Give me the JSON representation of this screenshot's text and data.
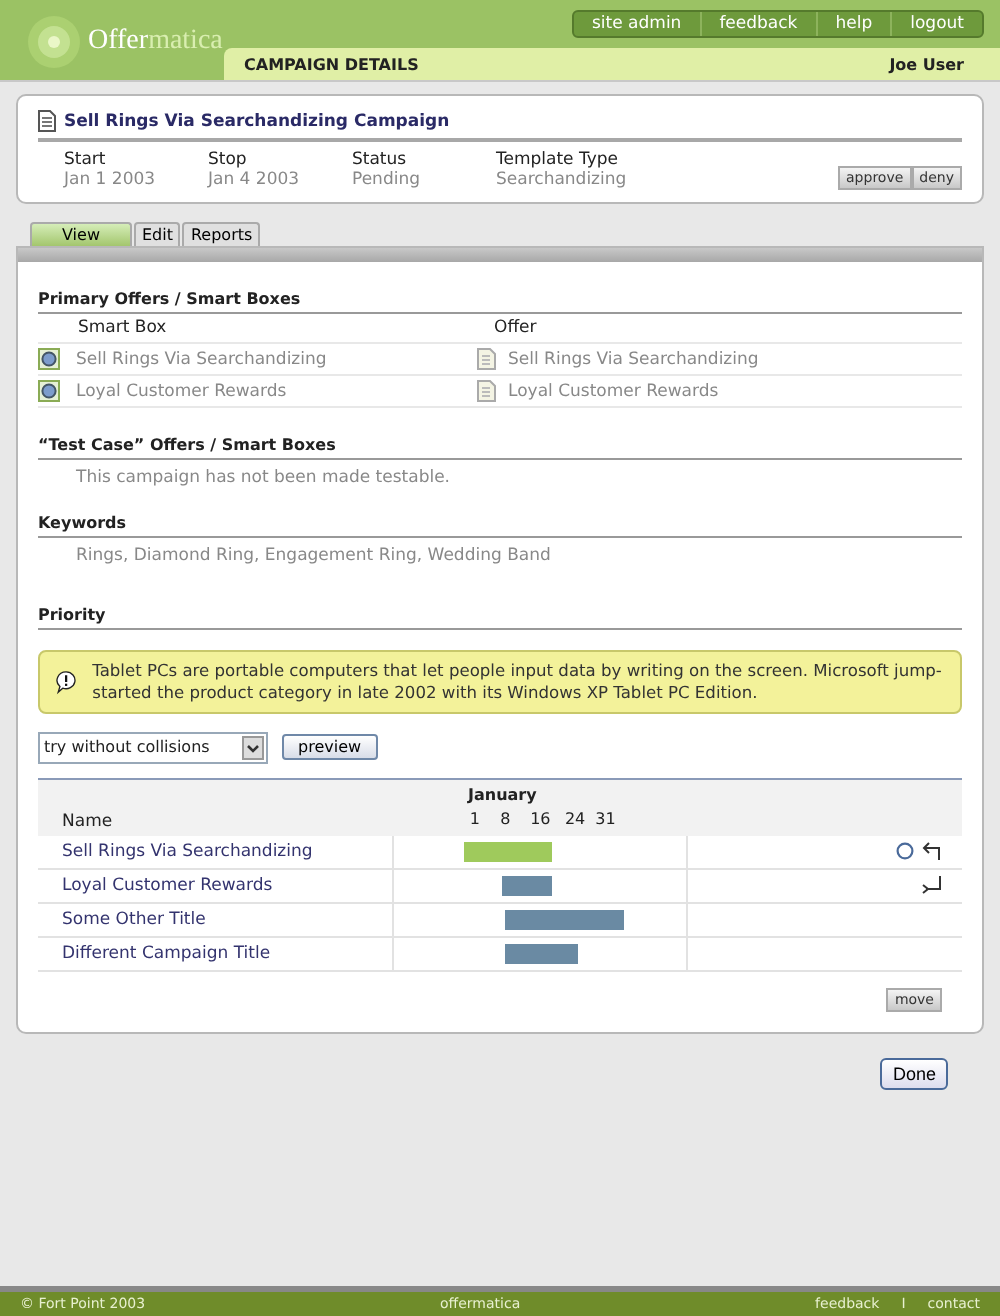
{
  "header": {
    "logo": [
      "Offer",
      "matica"
    ],
    "nav": [
      "site admin",
      "feedback",
      "help",
      "logout"
    ],
    "section_title": "CAMPAIGN DETAILS",
    "user": "Joe User"
  },
  "campaign": {
    "title": "Sell Rings Via Searchandizing Campaign",
    "fields": [
      {
        "label": "Start",
        "value": "Jan 1 2003"
      },
      {
        "label": "Stop",
        "value": "Jan 4 2003"
      },
      {
        "label": "Status",
        "value": "Pending"
      },
      {
        "label": "Template Type",
        "value": "Searchandizing"
      }
    ],
    "buttons": [
      "approve",
      "deny"
    ]
  },
  "tabs": [
    {
      "label": "View",
      "selected": true
    },
    {
      "label": "Edit",
      "selected": false
    },
    {
      "label": "Reports",
      "selected": false
    }
  ],
  "primary": {
    "heading": "Primary Offers / Smart Boxes",
    "columns": [
      "Smart Box",
      "Offer"
    ],
    "rows": [
      {
        "smart_box": "Sell Rings Via Searchandizing",
        "offer": "Sell Rings Via Searchandizing"
      },
      {
        "smart_box": "Loyal Customer Rewards",
        "offer": "Loyal Customer Rewards"
      }
    ]
  },
  "test_case": {
    "heading": "“Test Case” Offers / Smart Boxes",
    "text": "This campaign has not been made testable."
  },
  "keywords": {
    "heading": "Keywords",
    "text": "Rings, Diamond Ring, Engagement Ring, Wedding Band"
  },
  "priority": {
    "heading": "Priority",
    "notice": "Tablet PCs are portable computers that let people input data by writing on the screen. Microsoft jump-started the product category in late 2002 with its Windows XP Tablet PC Edition.",
    "select": "try without collisions",
    "preview_button": "preview",
    "name_column": "Name",
    "month": "January",
    "days": [
      "1",
      "8",
      "16",
      "24",
      "31"
    ],
    "rows": [
      {
        "name": "Sell Rings Via Searchandizing",
        "selected": true,
        "kind": "top",
        "bar": {
          "start": {
            "level": 0.24
          },
          "end": {
            "level": 0.54
          }
        }
      },
      {
        "name": "Loyal Customer Rewards",
        "selected": false,
        "kind": "bottom",
        "bar": {
          "start": {
            "level": 0.37
          },
          "end": {
            "level": 0.54
          }
        }
      },
      {
        "name": "Some Other Title",
        "selected": false,
        "kind": "plain",
        "bar": {
          "start": {
            "level": 0.38
          },
          "end": {
            "level": 0.79
          }
        }
      },
      {
        "name": "Different Campaign Title",
        "selected": false,
        "kind": "plain",
        "bar": {
          "start": {
            "level": 0.38
          },
          "end": {
            "level": 0.63
          }
        }
      }
    ],
    "move_button": "move"
  },
  "done_button": "Done",
  "footer": {
    "copyright": "© Fort Point 2003",
    "center": "offermatica",
    "links": [
      "feedback",
      "contact"
    ],
    "separator": "I"
  }
}
